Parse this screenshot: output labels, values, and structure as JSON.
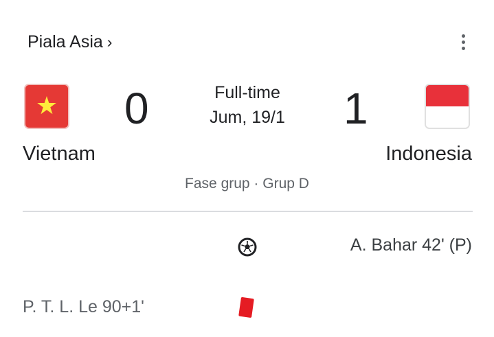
{
  "header": {
    "competition": "Piala Asia",
    "chevron": "›",
    "menu_icon": "more-vert-icon"
  },
  "match": {
    "status": "Full-time",
    "date": "Jum, 19/1",
    "stage": "Fase grup · Grup D",
    "home": {
      "name": "Vietnam",
      "score": "0",
      "flag_colors": [
        "#e53935",
        "#ffeb3b"
      ]
    },
    "away": {
      "name": "Indonesia",
      "score": "1",
      "flag_colors": [
        "#e8313a",
        "#ffffff"
      ]
    }
  },
  "events": [
    {
      "side": "away",
      "text": "A. Bahar 42' (P)",
      "icon": "soccer-ball-icon"
    },
    {
      "side": "home",
      "text": "P. T. L. Le 90+1'",
      "icon": "red-card-icon",
      "color": "#e51c23"
    }
  ]
}
